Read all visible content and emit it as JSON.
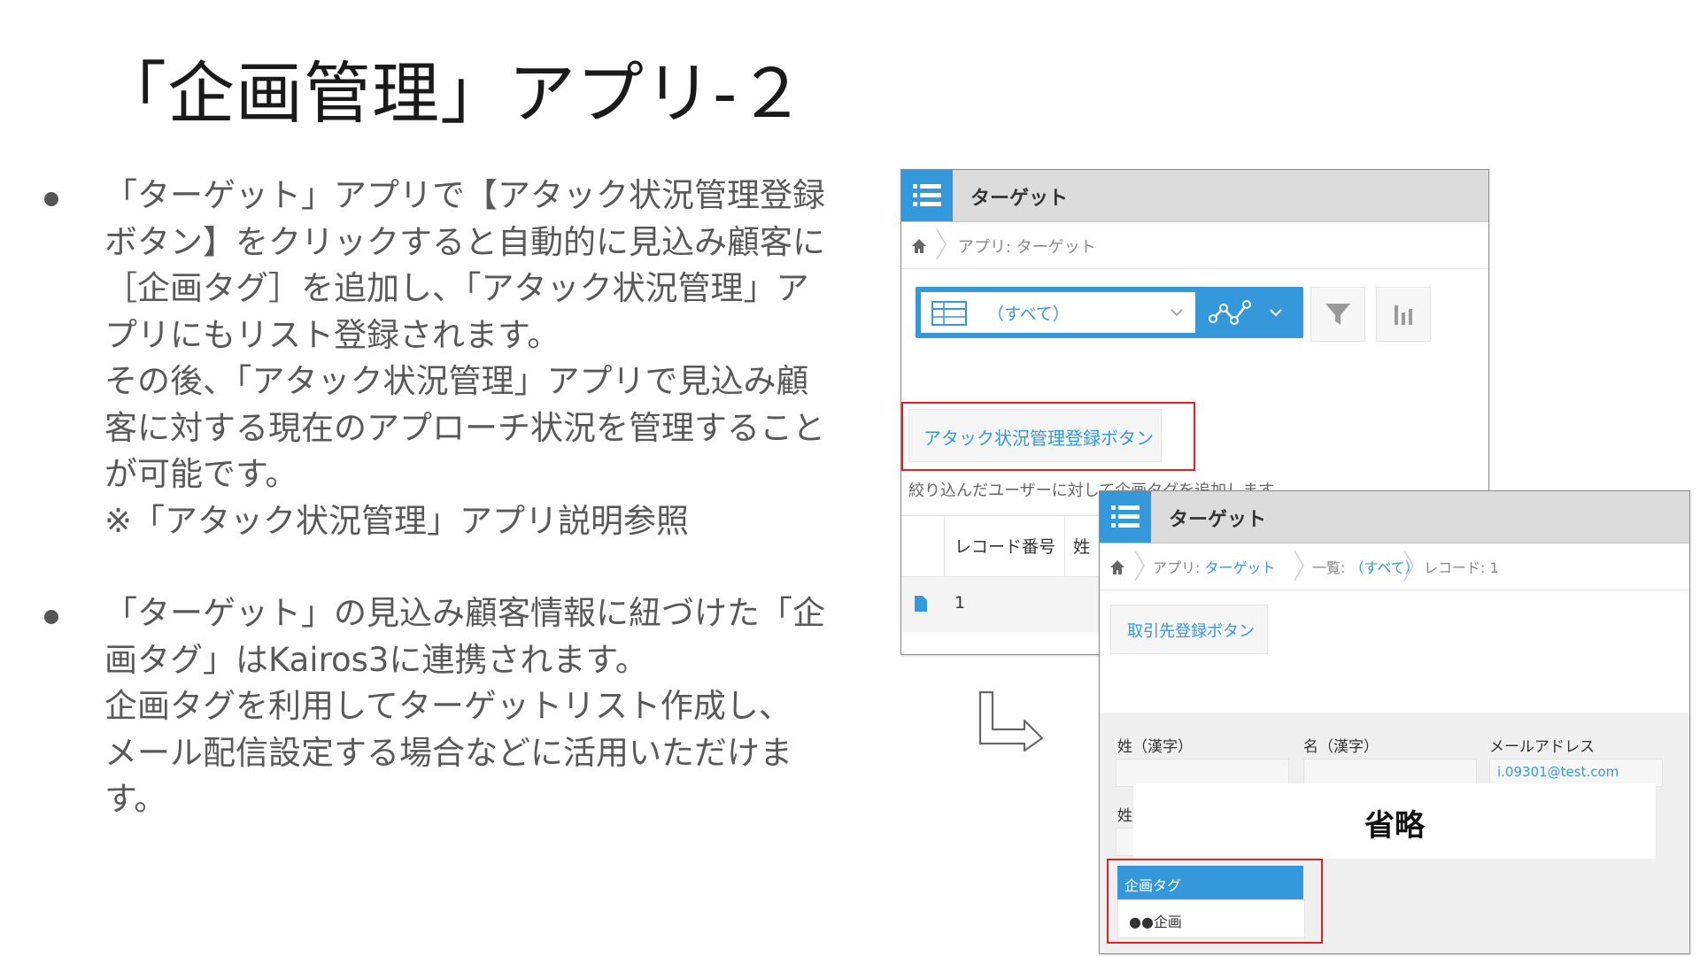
{
  "slide": {
    "title": "「企画管理」アプリ-２"
  },
  "bullets": [
    {
      "lines": [
        "「ターゲット」アプリで【アタック状況管理登録",
        "ボタン】をクリックすると自動的に見込み顧客に",
        "［企画タグ］を追加し、「アタック状況管理」ア",
        "プリにもリスト登録されます。",
        "その後、「アタック状況管理」アプリで見込み顧",
        "客に対する現在のアプローチ状況を管理すること",
        "が可能です。",
        "※「アタック状況管理」アプリ説明参照"
      ]
    },
    {
      "lines": [
        "「ターゲット」の見込み顧客情報に紐づけた「企",
        "画タグ」はKairos3に連携されます。",
        "企画タグを利用してターゲットリスト作成し、",
        "メール配信設定する場合などに活用いただけま",
        "す。"
      ]
    }
  ],
  "window1": {
    "app_title": "ターゲット",
    "breadcrumb_app": "アプリ: ターゲット",
    "view_select": "（すべて）",
    "attack_button": "アタック状況管理登録ボタン",
    "filter_note": "絞り込んだユーザーに対して企画タグを追加します",
    "table": {
      "headers": [
        "レコード番号",
        "姓"
      ],
      "rows": [
        [
          "1"
        ]
      ]
    }
  },
  "window2": {
    "app_title": "ターゲット",
    "breadcrumb": {
      "app_prefix": "アプリ: ",
      "app_link": "ターゲット",
      "list_prefix": "一覧: ",
      "list_link": "（すべて）",
      "record": "レコード: 1"
    },
    "client_button": "取引先登録ボタン",
    "fields": {
      "last_name_label": "姓（漢字）",
      "first_name_label": "名（漢字）",
      "email_label": "メールアドレス",
      "email_value": "i.09301@test.com",
      "partial_label": "姓"
    },
    "omitted": "省略",
    "plan_tag": {
      "label": "企画タグ",
      "value": "●●企画"
    }
  },
  "colors": {
    "kintone_blue": "#3498db",
    "highlight_red": "#e02020"
  }
}
